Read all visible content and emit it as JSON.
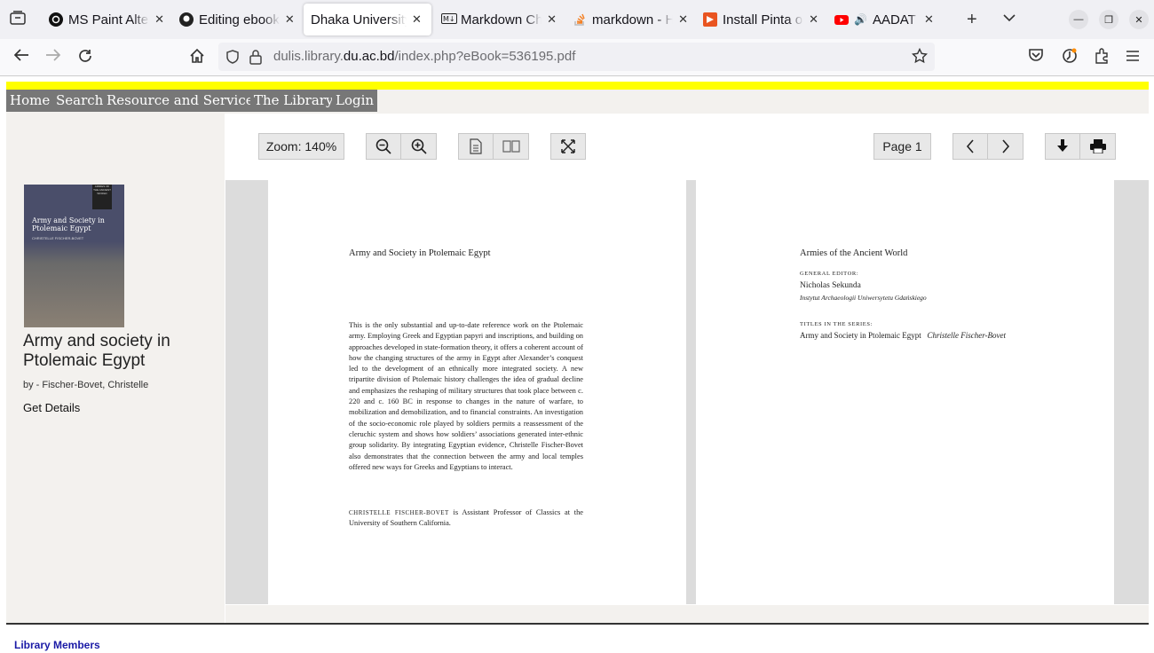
{
  "browser": {
    "tabs": [
      {
        "label": "MS Paint Alternatives",
        "icon": "threads-icon"
      },
      {
        "label": "Editing ebook",
        "icon": "github-icon"
      },
      {
        "label": "Dhaka University",
        "icon": "none",
        "active": true
      },
      {
        "label": "Markdown Cheatsheet",
        "icon": "markdown-icon"
      },
      {
        "label": "markdown - How",
        "icon": "stackoverflow-icon"
      },
      {
        "label": "Install Pinta on",
        "icon": "snapcraft-icon"
      },
      {
        "label": "AADAT - Wo",
        "icon": "youtube-icon",
        "audio": true
      }
    ],
    "url_prefix": "dulis.library.",
    "url_domain": "du.ac.bd",
    "url_path": "/index.php?eBook=536195.pdf"
  },
  "menu": {
    "items": [
      "Home",
      "Search",
      "Resource and Services",
      "The Library",
      "Login"
    ]
  },
  "sidebar": {
    "cover_title": "Army and Society in Ptolemaic Egypt",
    "cover_author": "CHRISTELLE FISCHER-BOVET",
    "cover_series": "ARMIES OF THE ANCIENT WORLD",
    "book_title": "Army and society in Ptolemaic Egypt",
    "author": "by - Fischer-Bovet, Christelle",
    "details_link": "Get Details",
    "members_link": "Library Members"
  },
  "viewer": {
    "zoom_label": "Zoom: 140%",
    "page_label": "Page 1"
  },
  "left_page": {
    "heading": "Army and Society in Ptolemaic Egypt",
    "body": "This is the only substantial and up-to-date reference work on the Ptolemaic army. Employing Greek and Egyptian papyri and inscriptions, and building on approaches developed in state-formation theory, it offers a coherent account of how the changing structures of the army in Egypt after Alexander’s conquest led to the development of an ethnically more integrated society. A new tripartite division of Ptolemaic history challenges the idea of gradual decline and emphasizes the reshaping of military structures that took place between c. 220 and c. 160 BC in response to changes in the nature of warfare, to mobilization and demobilization, and to financial constraints. An investigation of the socio-economic role played by soldiers permits a reassessment of the cleruchic system and shows how soldiers’ associations generated inter-ethnic group solidarity. By integrating Egyptian evidence, Christelle Fischer-Bovet also demonstrates that the connection between the army and local temples offered new ways for Greeks and Egyptians to interact.",
    "author_note_name": "CHRISTELLE FISCHER-BOVET",
    "author_note": " is Assistant Professor of Classics at the University of Southern California."
  },
  "right_page": {
    "series": "Armies of the Ancient World",
    "editor_label": "GENERAL EDITOR:",
    "editor_name": "Nicholas Sekunda",
    "editor_affil": "Instytut Archaeologii Uniwersytetu Gdańskiego",
    "titles_label": "TITLES IN THE SERIES:",
    "title_entry": "Army and Society in Ptolemaic Egypt",
    "title_author": "Christelle Fischer-Bovet"
  }
}
